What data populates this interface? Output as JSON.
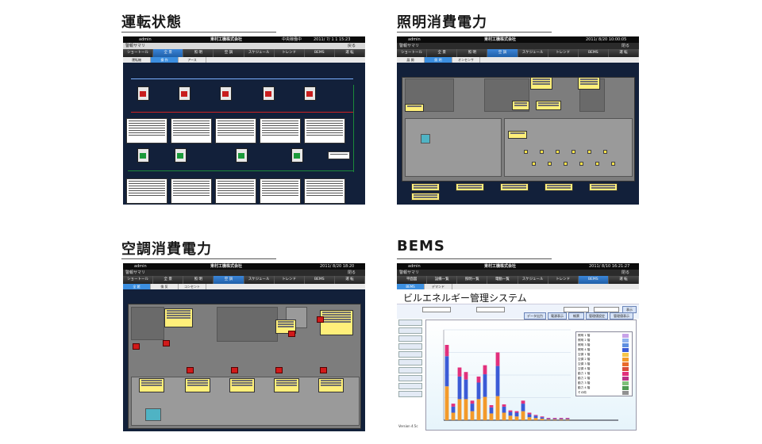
{
  "panels": {
    "operation": {
      "title": "運転状態"
    },
    "lighting": {
      "title": "照明消費電力"
    },
    "hvac": {
      "title": "空調消費電力"
    },
    "bems": {
      "title": "BEMS"
    }
  },
  "operation_screen": {
    "login": "admin",
    "company": "東村工機株式会社",
    "status": "中央稼働中",
    "clock": "2011/ 7/ 1 1 15:23",
    "alarm": "警報サマリ",
    "back": "戻る",
    "nav": [
      "ショートール",
      "全 景",
      "照 明",
      "空 調",
      "スケジュール",
      "トレンド",
      "BEMS",
      "運 転"
    ],
    "tabs": [
      "運転機",
      "操 作",
      "アース"
    ]
  },
  "lighting_screen": {
    "login": "admin",
    "company": "東村工機株式会社",
    "clock": "2011/ 8/20 10:00:05",
    "alarm": "警報サマリ",
    "close": "閉る",
    "nav": [
      "ショートール",
      "全 景",
      "照 明",
      "空 調",
      "スケジュール",
      "トレンド",
      "BEMS",
      "運 転"
    ],
    "tabs": [
      "展 開",
      "照 明",
      "オンセンサ"
    ]
  },
  "hvac_screen": {
    "login": "admin",
    "company": "東村工機株式会社",
    "clock": "2011/ 8/20 18:20",
    "alarm": "警報サマリ",
    "close": "閉る",
    "nav": [
      "ショートール",
      "全 景",
      "照 明",
      "空 調",
      "スケジュール",
      "トレンド",
      "BEMS",
      "運 転"
    ],
    "tabs": [
      "全 館",
      "換 気",
      "コンセント"
    ]
  },
  "bems_screen": {
    "login": "admin",
    "company": "東村工機株式会社",
    "clock": "2011/ 8/10 16:21:27",
    "alarm": "警報サマリ",
    "close": "閉る",
    "nav": [
      "平面図",
      "設備一覧",
      "照明一覧",
      "電動一覧",
      "スケジュール",
      "トレンド",
      "BEMS",
      "運 転"
    ],
    "tabs": [
      "BEMS",
      "デマンド"
    ],
    "heading": "ビルエネルギー管理システム",
    "version": "Version 4.5c",
    "buttons": [
      "表示",
      "データ出力",
      "電源表示",
      "帳票",
      "管理値設定",
      "管理値表示"
    ]
  },
  "colors": {
    "dark_bg": "#12203a",
    "nav_active": "#2f7ad0",
    "info_box": "#ffef7a",
    "unit_red": "#d11a1a",
    "bar_orange": "#f39a2a",
    "bar_blue": "#3b5bd6",
    "bar_pink": "#e2307c"
  },
  "chart_data": {
    "type": "bar",
    "categories": [
      "1",
      "2",
      "3",
      "4",
      "5",
      "6",
      "7",
      "8",
      "9",
      "10",
      "11",
      "12",
      "13",
      "14",
      "15",
      "16",
      "17",
      "18",
      "19",
      "20"
    ],
    "series": [
      {
        "values": [
          45,
          10,
          28,
          28,
          12,
          28,
          31,
          9,
          32,
          10,
          6,
          5,
          12,
          4,
          3,
          2,
          1,
          1,
          1,
          1
        ]
      },
      {
        "values": [
          40,
          8,
          30,
          26,
          10,
          22,
          30,
          8,
          40,
          8,
          5,
          5,
          10,
          4,
          3,
          2,
          1,
          1,
          1,
          1
        ]
      },
      {
        "values": [
          15,
          4,
          12,
          10,
          4,
          8,
          12,
          3,
          18,
          3,
          2,
          2,
          4,
          2,
          1,
          1,
          1,
          1,
          1,
          1
        ]
      }
    ],
    "ylim": [
      0,
      120
    ],
    "legend": [
      "照明 1 階",
      "照明 2 階",
      "照明 3 階",
      "照明 4 階",
      "空調 1 階",
      "空調 2 階",
      "空調 3 階",
      "空調 4 階",
      "動力 1 階",
      "動力 2 階",
      "動力 3 階",
      "動力 4 階",
      "その他"
    ]
  }
}
